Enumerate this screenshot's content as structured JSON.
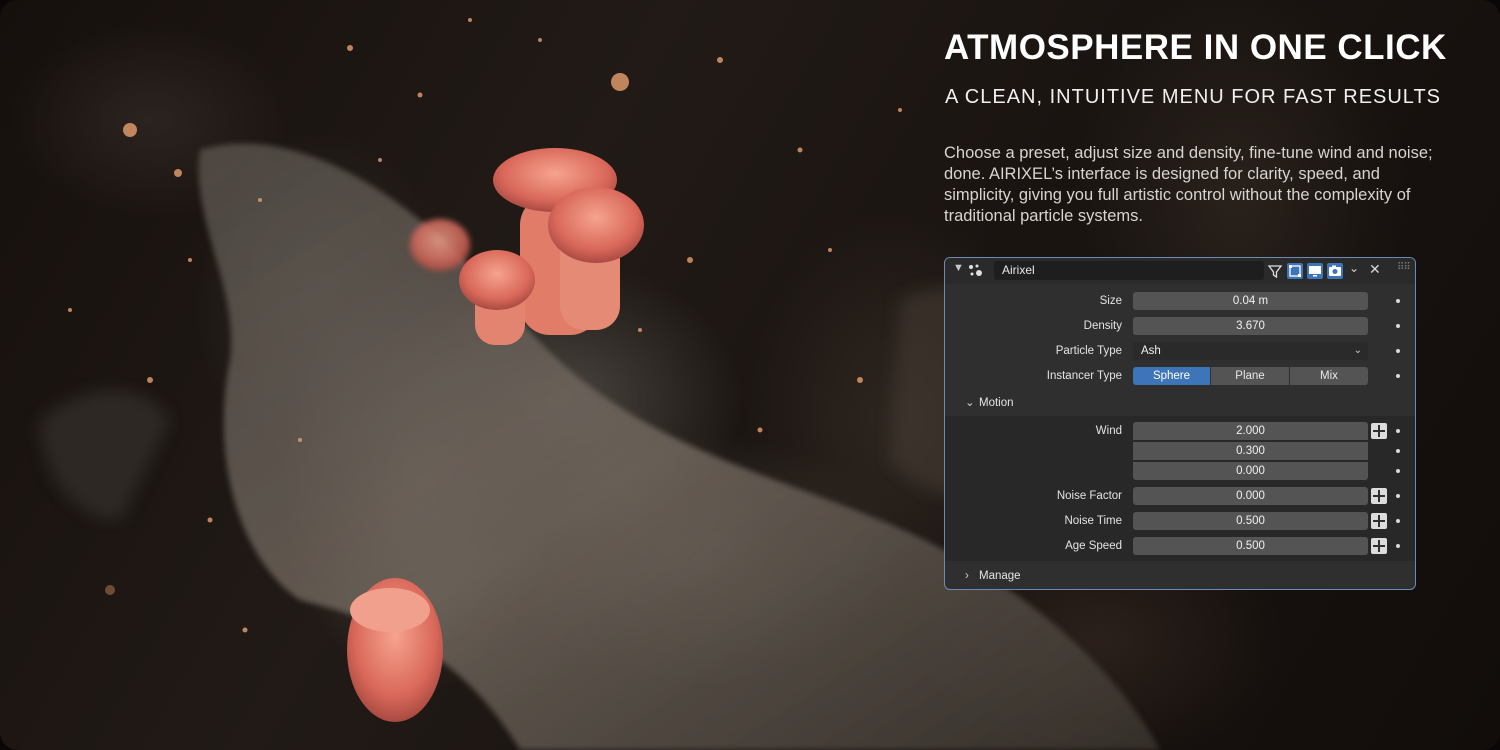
{
  "hero": {
    "title": "ATMOSPHERE IN ONE CLICK",
    "subtitle": "A CLEAN, INTUITIVE MENU FOR FAST RESULTS",
    "description": "Choose a preset, adjust size and density, fine-tune wind and noise; done. AIRIXEL’s interface is designed for clarity, speed, and simplicity, giving you full artistic control without the complexity of traditional particle systems."
  },
  "panel": {
    "name": "Airixel",
    "close_icon": "✕",
    "collapse_icon": "⌄",
    "fields": {
      "size": {
        "label": "Size",
        "value": "0.04 m"
      },
      "density": {
        "label": "Density",
        "value": "3.670"
      },
      "particle_type": {
        "label": "Particle Type",
        "value": "Ash"
      },
      "instancer_type": {
        "label": "Instancer Type",
        "options": [
          "Sphere",
          "Plane",
          "Mix"
        ],
        "selected": "Sphere"
      }
    },
    "motion": {
      "label": "Motion",
      "wind": {
        "label": "Wind",
        "values": [
          "2.000",
          "0.300",
          "0.000"
        ]
      },
      "noise_factor": {
        "label": "Noise Factor",
        "value": "0.000"
      },
      "noise_time": {
        "label": "Noise Time",
        "value": "0.500"
      },
      "age_speed": {
        "label": "Age Speed",
        "value": "0.500"
      }
    },
    "manage": {
      "label": "Manage"
    }
  },
  "colors": {
    "accent": "#3e74b8",
    "panel_bg": "#2f2f2f",
    "field_bg": "#545454",
    "panel_border": "#6b8bb3"
  }
}
